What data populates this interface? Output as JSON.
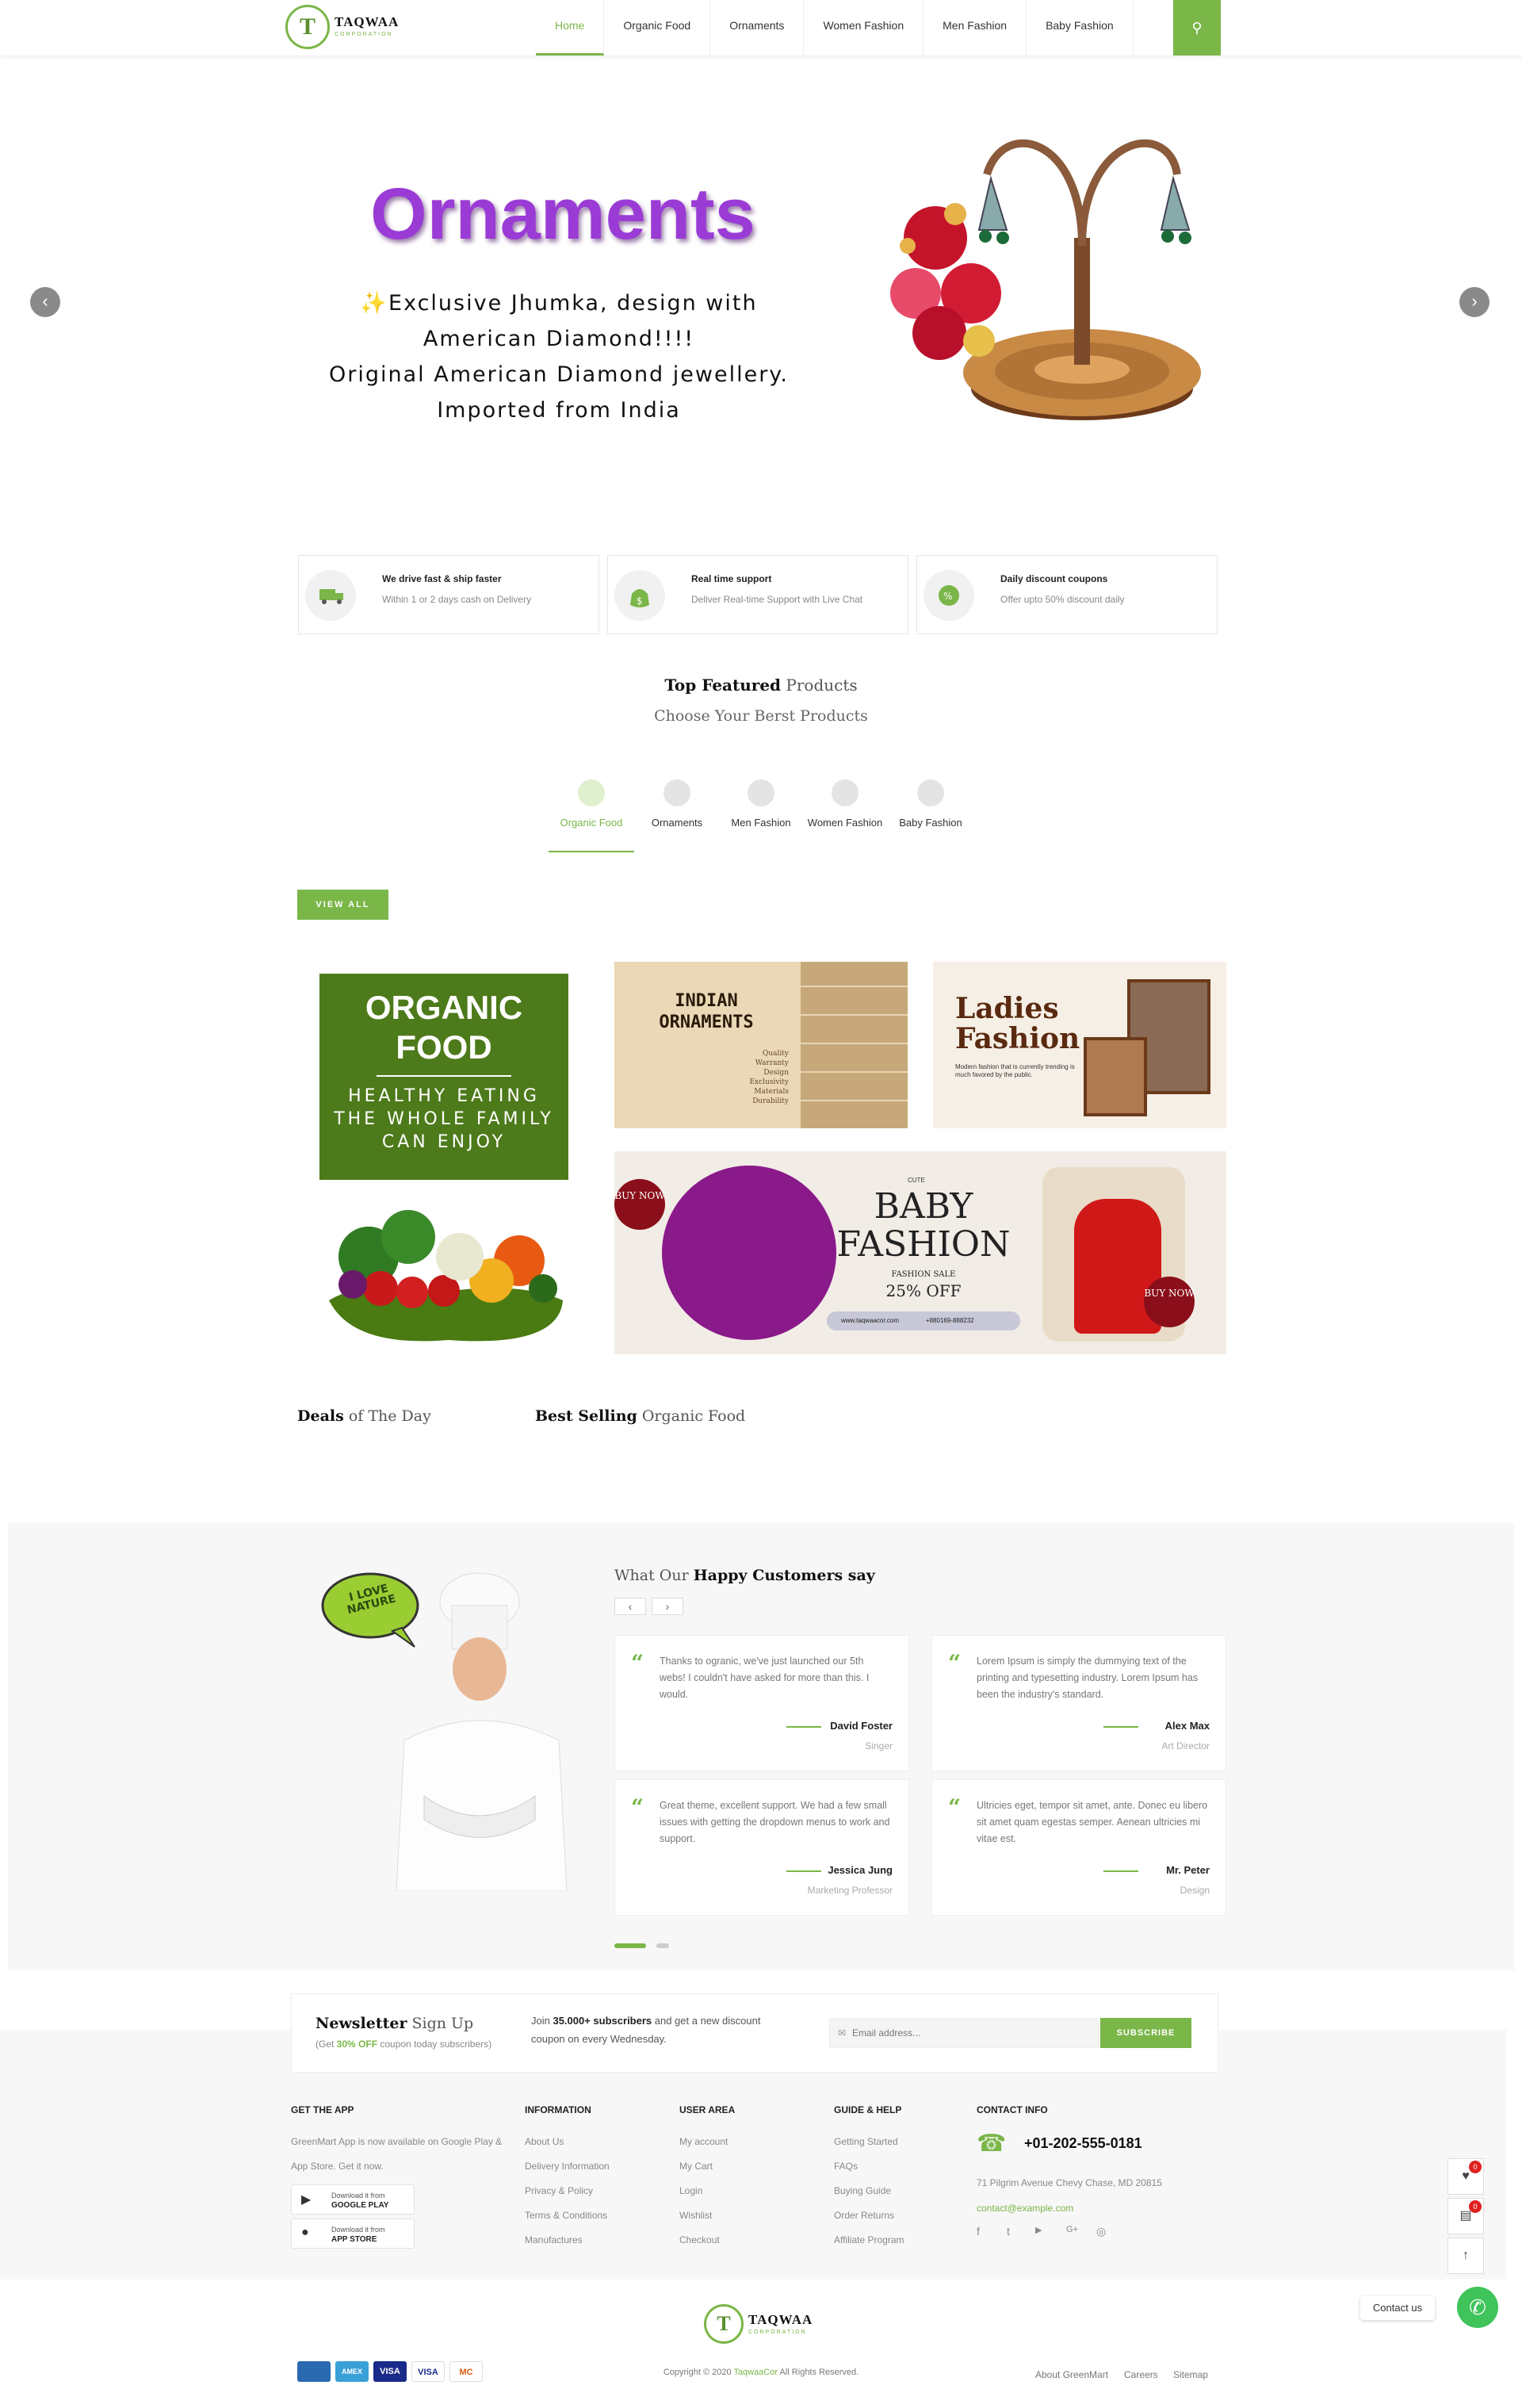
{
  "header": {
    "logo_letter": "T",
    "logo_name": "TAQWAA",
    "logo_sub": "CORPORATION",
    "nav": [
      "Home",
      "Organic Food",
      "Ornaments",
      "Women Fashion",
      "Men Fashion",
      "Baby Fashion"
    ],
    "accent_color": "#7ab648"
  },
  "hero": {
    "title": "Ornaments",
    "lines": [
      "✨Exclusive Jhumka, design with",
      "American Diamond!!!!",
      "Original American Diamond jewellery.",
      "Imported from India"
    ]
  },
  "features": [
    {
      "title": "We drive fast & ship faster",
      "sub": "Within 1 or 2 days cash on Delivery",
      "icon": "truck-icon"
    },
    {
      "title": "Real time support",
      "sub": "Deliver Real-time Support with Live Chat",
      "icon": "money-bag-icon"
    },
    {
      "title": "Daily discount coupons",
      "sub": "Offer upto 50% discount daily",
      "icon": "percent-badge-icon"
    }
  ],
  "featured": {
    "title_bold": "Top Featured",
    "title_rest": " Products",
    "subtitle": "Choose Your Berst Products",
    "tabs": [
      "Organic Food",
      "Ornaments",
      "Men Fashion",
      "Women Fashion",
      "Baby Fashion"
    ],
    "view_all": "VIEW ALL"
  },
  "banners": {
    "organic_title_1": "ORGANIC",
    "organic_title_2": "FOOD",
    "organic_sub": [
      "HEALTHY EATING",
      "THE WHOLE FAMILY",
      "CAN ENJOY"
    ],
    "indian_1": "INDIAN",
    "indian_2": "ORNAMENTS",
    "indian_list": [
      "Quality",
      "Warranty",
      "Design",
      "Exclusivity",
      "Materials",
      "Durability"
    ],
    "ladies_1": "Ladies",
    "ladies_2": "Fashion",
    "ladies_sub": "Modern fashion that is currently trending is much favored by the public.",
    "baby_cute": "CUTE",
    "baby_1": "BABY",
    "baby_2": "FASHION",
    "baby_sale": "FASHION SALE",
    "baby_off": "25% OFF",
    "baby_buy": "BUY NOW",
    "baby_web": "www.taqwaacor.com",
    "baby_phone": "+880169-888232"
  },
  "deals": {
    "deal_bold": "Deals",
    "deal_rest": " of The Day",
    "best_bold": "Best Selling",
    "best_rest": " Organic Food"
  },
  "testimonials": {
    "badge_1": "I LOVE",
    "badge_2": "NATURE",
    "title_pre": "What Our ",
    "title_bold": "Happy Customers say",
    "prev": "‹",
    "next": "›",
    "items": [
      {
        "text": "Thanks to ogranic, we've just launched our 5th webs! I couldn't have asked for more than this. I would.",
        "name": "David Foster",
        "role": "Singer"
      },
      {
        "text": "Lorem Ipsum is simply the dummying text of the printing and typesetting industry. Lorem Ipsum has been the industry's standard.",
        "name": "Alex Max",
        "role": "Art Director"
      },
      {
        "text": "Great theme, excellent support. We had a few small issues with getting the dropdown menus to work and support.",
        "name": "Jessica Jung",
        "role": "Marketing Professor"
      },
      {
        "text": "Ultricies eget, tempor sit amet, ante. Donec eu libero sit amet quam egestas semper. Aenean ultricies mi vitae est.",
        "name": "Mr. Peter",
        "role": "Design"
      }
    ]
  },
  "newsletter": {
    "title_bold": "Newsletter",
    "title_rest": " Sign Up",
    "sub_pre": "(Get ",
    "sub_green": "30% OFF",
    "sub_post": " coupon today subscribers)",
    "join_pre": "Join ",
    "join_bold": "35.000+ subscribers",
    "join_post": " and get a new discount coupon on every Wednesday.",
    "placeholder": "Email address...",
    "button": "SUBSCRIBE"
  },
  "footer": {
    "app_title": "GET THE APP",
    "app_text": "GreenMart App is now available on Google Play & App Store. Get it now.",
    "google_1": "Download it from",
    "google_2": "GOOGLE PLAY",
    "apple_1": "Download it from",
    "apple_2": "APP STORE",
    "cols": [
      {
        "title": "INFORMATION",
        "links": [
          "About Us",
          "Delivery Information",
          "Privacy & Policy",
          "Terms & Conditions",
          "Manufactures"
        ]
      },
      {
        "title": "USER AREA",
        "links": [
          "My account",
          "My Cart",
          "Login",
          "Wishlist",
          "Checkout"
        ]
      },
      {
        "title": "GUIDE & HELP",
        "links": [
          "Getting Started",
          "FAQs",
          "Buying Guide",
          "Order Returns",
          "Affiliate Program"
        ]
      }
    ],
    "contact_title": "CONTACT INFO",
    "phone": "+01-202-555-0181",
    "address": "71 Pilgrim Avenue Chevy Chase, MD 20815",
    "email": "contact@example.com",
    "socials": [
      "f",
      "t",
      "▶",
      "G+",
      "◎"
    ],
    "copyright_pre": "Copyright © 2020 ",
    "copyright_brand": "TaqwaaCor",
    "copyright_post": " All Rights Reserved.",
    "bottom_links": [
      "About GreenMart",
      "Careers",
      "Sitemap"
    ],
    "payments": [
      "",
      "AMEX",
      "VISA",
      "VISA",
      "MC"
    ]
  },
  "side": {
    "wishlist_count": "0",
    "cart_count": "0",
    "contact_label": "Contact us"
  }
}
